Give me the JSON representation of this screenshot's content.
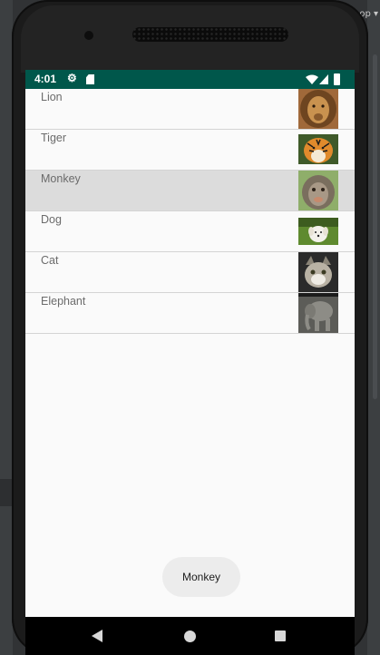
{
  "status_bar": {
    "time": "4:01",
    "color": "#00574b",
    "icons": [
      "gear-icon",
      "sd-card-icon",
      "wifi-icon",
      "signal-icon",
      "battery-icon"
    ]
  },
  "animals": [
    {
      "label": "Lion",
      "image": "lion-photo"
    },
    {
      "label": "Tiger",
      "image": "tiger-photo"
    },
    {
      "label": "Monkey",
      "image": "monkey-photo",
      "selected": true
    },
    {
      "label": "Dog",
      "image": "dog-photo"
    },
    {
      "label": "Cat",
      "image": "cat-photo"
    },
    {
      "label": "Elephant",
      "image": "elephant-photo"
    }
  ],
  "toast": {
    "text": "Monkey"
  },
  "nav_bar": {
    "icons": [
      "back-icon",
      "home-icon",
      "recents-icon"
    ]
  },
  "ide": {
    "tab_label": "op"
  }
}
